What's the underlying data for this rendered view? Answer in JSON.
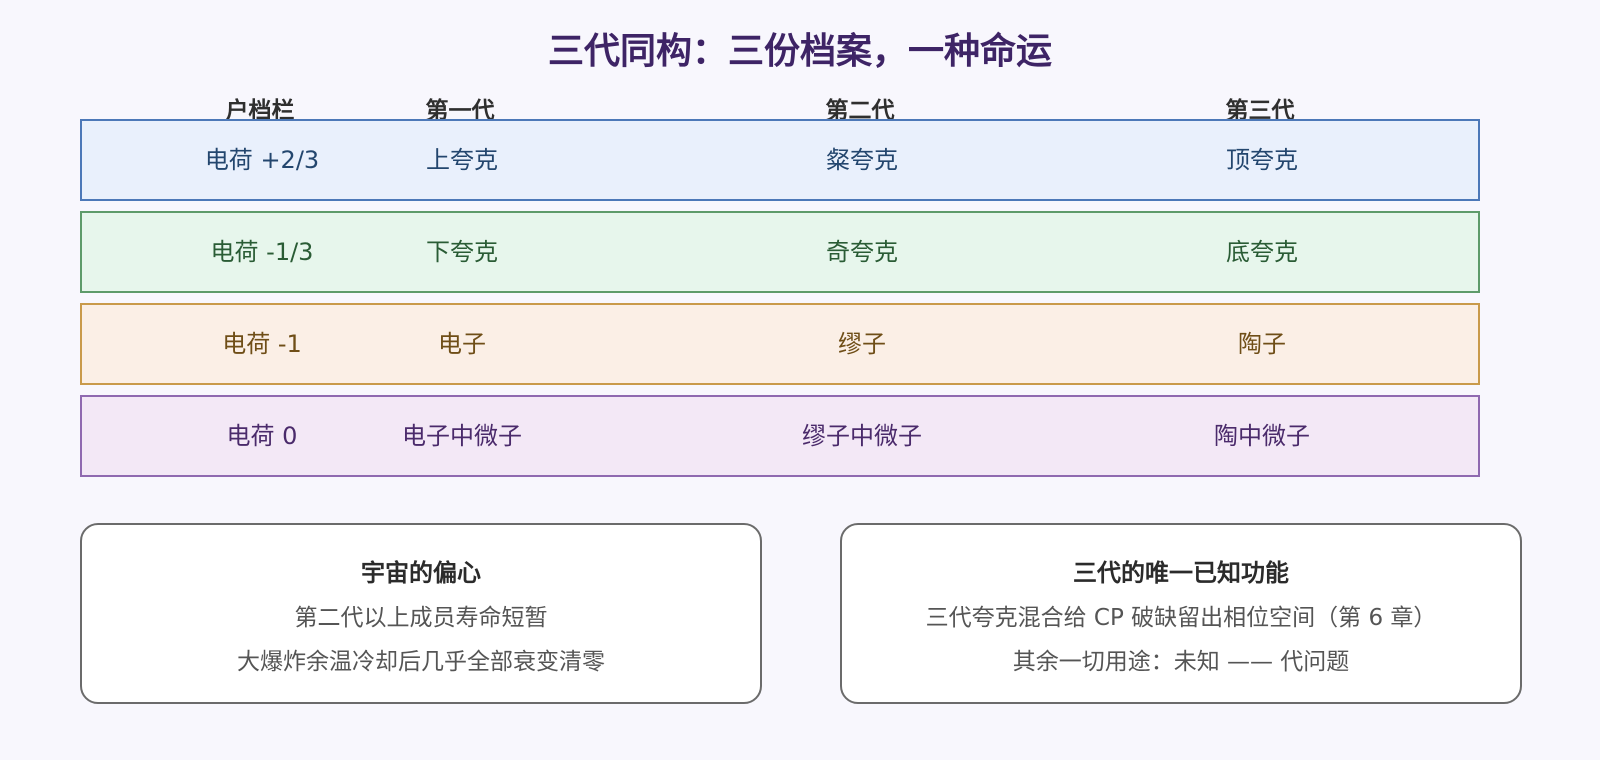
{
  "title": "三代同构：三份档案，一种命运",
  "headers": [
    "户档栏",
    "第一代",
    "第二代",
    "第三代"
  ],
  "rows": [
    {
      "label": "电荷 +2/3",
      "gen1": "上夸克",
      "gen2": "粲夸克",
      "gen3": "顶夸克"
    },
    {
      "label": "电荷 -1/3",
      "gen1": "下夸克",
      "gen2": "奇夸克",
      "gen3": "底夸克"
    },
    {
      "label": "电荷 -1",
      "gen1": "电子",
      "gen2": "缪子",
      "gen3": "陶子"
    },
    {
      "label": "电荷 0",
      "gen1": "电子中微子",
      "gen2": "缪子中微子",
      "gen3": "陶中微子"
    }
  ],
  "row_colors": [
    "#e9f0fc",
    "#e7f6ec",
    "#fbefe6",
    "#f3e8f6"
  ],
  "boxes": [
    {
      "title": "宇宙的偏心",
      "lines": [
        "第二代以上成员寿命短暂",
        "大爆炸余温冷却后几乎全部衰变清零"
      ]
    },
    {
      "title": "三代的唯一已知功能",
      "lines": [
        "三代夸克混合给 CP 破缺留出相位空间（第 6 章）",
        "其余一切用途：未知 —— 代问题"
      ]
    }
  ]
}
